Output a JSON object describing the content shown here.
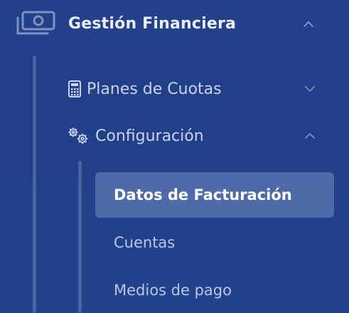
{
  "colors": {
    "background": "#23418a",
    "active_background": "#4f6aa8",
    "text_primary": "#e8edf8",
    "text_secondary": "#c9d3ec",
    "guide_line": "#4a64a3"
  },
  "sidebar": {
    "section": {
      "label": "Gestión Financiera",
      "icon": "money-icon",
      "expanded": true
    },
    "items": [
      {
        "label": "Planes de Cuotas",
        "icon": "calculator-icon",
        "expanded": false
      },
      {
        "label": "Configuración",
        "icon": "gears-icon",
        "expanded": true,
        "children": [
          {
            "label": "Datos de Facturación",
            "active": true
          },
          {
            "label": "Cuentas",
            "active": false
          },
          {
            "label": "Medios de pago",
            "active": false
          }
        ]
      }
    ]
  }
}
